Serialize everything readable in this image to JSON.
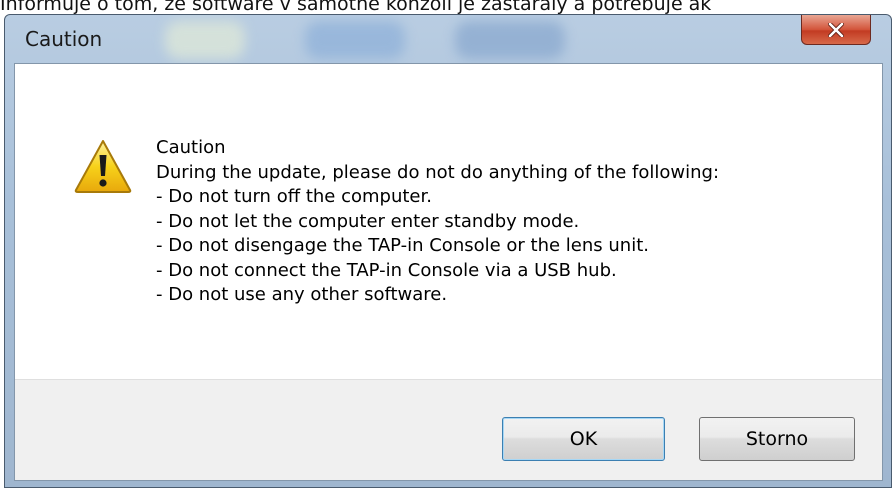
{
  "background_text": "Informuje o tom, že software v samotné konzoli je zastaralý a potřebuje ak",
  "window": {
    "title": "Caution"
  },
  "dialog": {
    "heading": "Caution",
    "intro": "During the update, please do not do anything of the following:",
    "items": [
      "- Do not turn off the computer.",
      "- Do not let the computer enter standby mode.",
      "- Do not disengage the TAP-in Console or the lens unit.",
      "- Do not connect the TAP-in Console via a USB hub.",
      "- Do not use any other software."
    ],
    "icon": "warning-triangle-icon"
  },
  "buttons": {
    "ok_label": "OK",
    "cancel_label": "Storno"
  },
  "colors": {
    "close_button": "#c7452a",
    "warning_yellow": "#f7d21a",
    "default_button_border": "#3c7fb1"
  }
}
